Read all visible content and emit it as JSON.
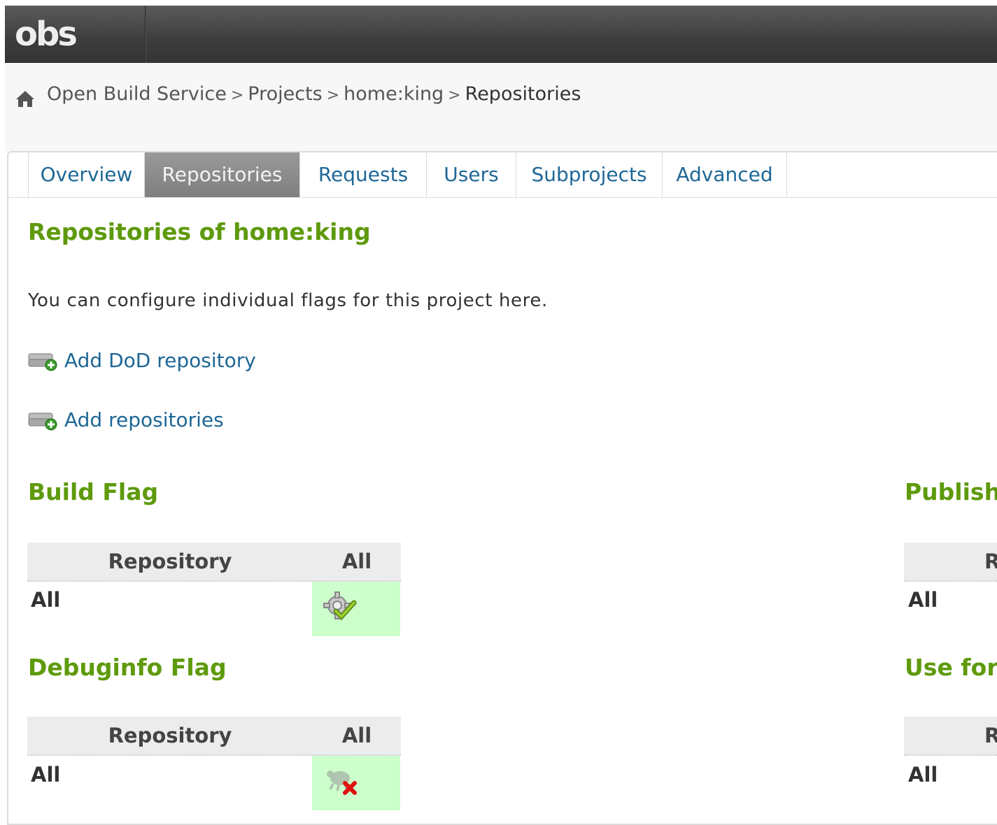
{
  "header": {
    "logo": "obs"
  },
  "breadcrumb": {
    "items": [
      "Open Build Service",
      "Projects",
      "home:king"
    ],
    "separator": ">",
    "current": "Repositories"
  },
  "tabs": [
    {
      "label": "Overview",
      "active": false
    },
    {
      "label": "Repositories",
      "active": true
    },
    {
      "label": "Requests",
      "active": false
    },
    {
      "label": "Users",
      "active": false
    },
    {
      "label": "Subprojects",
      "active": false
    },
    {
      "label": "Advanced",
      "active": false
    }
  ],
  "main": {
    "title": "Repositories of home:king",
    "intro": "You can configure individual flags for this project here.",
    "add_dod_link": "Add DoD repository",
    "add_repos_link": "Add repositories"
  },
  "flags": {
    "build": {
      "title": "Build Flag",
      "col_repository": "Repository",
      "col_all": "All",
      "row_label": "All",
      "state_icon": "build-enabled-icon"
    },
    "debuginfo": {
      "title": "Debuginfo Flag",
      "col_repository": "Repository",
      "col_all": "All",
      "row_label": "All",
      "state_icon": "debuginfo-disabled-icon"
    },
    "publish": {
      "title": "Publish",
      "col_repository": "R",
      "row_label": "All"
    },
    "useforbuild": {
      "title": "Use for",
      "col_repository": "R",
      "row_label": "All"
    }
  },
  "colors": {
    "heading_green": "#5e9a0c",
    "link_blue": "#1e6796",
    "flag_cell_bg": "#ccffcc",
    "topbar": "#3d3d3d"
  }
}
